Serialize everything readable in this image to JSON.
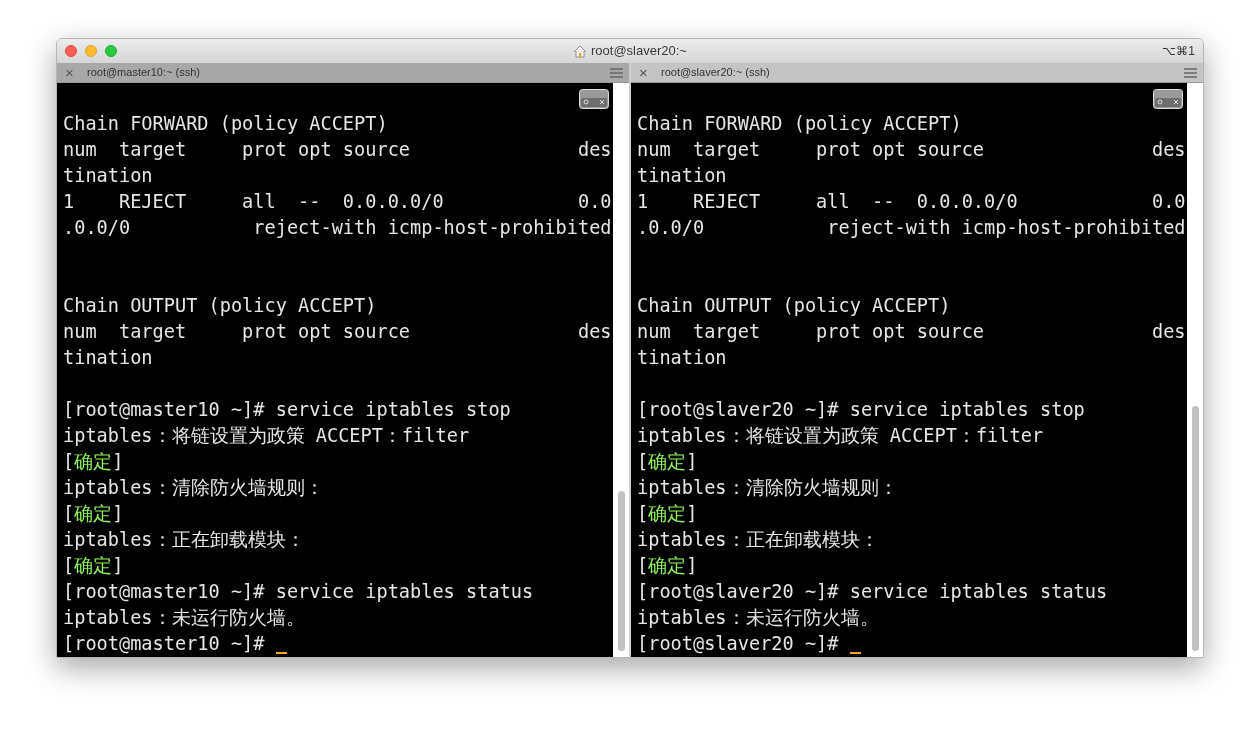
{
  "window": {
    "title": "root@slaver20:~",
    "shortcut": "⌥⌘1"
  },
  "panes": [
    {
      "tab": {
        "close": "×",
        "label": "root@master10:~ (ssh)"
      },
      "active": false,
      "lines": [
        {
          "kind": "blank"
        },
        {
          "kind": "text",
          "text": "Chain FORWARD (policy ACCEPT)"
        },
        {
          "kind": "text",
          "text": "num  target     prot opt source               des"
        },
        {
          "kind": "text",
          "text": "tination"
        },
        {
          "kind": "text",
          "text": "1    REJECT     all  --  0.0.0.0/0            0.0"
        },
        {
          "kind": "text",
          "text": ".0.0/0           reject-with icmp-host-prohibited"
        },
        {
          "kind": "blank"
        },
        {
          "kind": "blank"
        },
        {
          "kind": "text",
          "text": "Chain OUTPUT (policy ACCEPT)"
        },
        {
          "kind": "text",
          "text": "num  target     prot opt source               des"
        },
        {
          "kind": "text",
          "text": "tination"
        },
        {
          "kind": "blank"
        },
        {
          "kind": "text",
          "text": "[root@master10 ~]# service iptables stop"
        },
        {
          "kind": "text",
          "text": "iptables：将链设置为政策 ACCEPT：filter"
        },
        {
          "kind": "status",
          "open": "[",
          "status": "确定",
          "close": "]"
        },
        {
          "kind": "text",
          "text": "iptables：清除防火墙规则："
        },
        {
          "kind": "status",
          "open": "[",
          "status": "确定",
          "close": "]"
        },
        {
          "kind": "text",
          "text": "iptables：正在卸载模块："
        },
        {
          "kind": "status",
          "open": "[",
          "status": "确定",
          "close": "]"
        },
        {
          "kind": "text",
          "text": "[root@master10 ~]# service iptables status"
        },
        {
          "kind": "text",
          "text": "iptables：未运行防火墙。"
        },
        {
          "kind": "prompt",
          "text": "[root@master10 ~]#",
          "cursor": true
        }
      ]
    },
    {
      "tab": {
        "close": "×",
        "label": "root@slaver20:~ (ssh)"
      },
      "active": true,
      "lines": [
        {
          "kind": "blank"
        },
        {
          "kind": "text",
          "text": "Chain FORWARD (policy ACCEPT)"
        },
        {
          "kind": "text",
          "text": "num  target     prot opt source               des"
        },
        {
          "kind": "text",
          "text": "tination"
        },
        {
          "kind": "text",
          "text": "1    REJECT     all  --  0.0.0.0/0            0.0"
        },
        {
          "kind": "text",
          "text": ".0.0/0           reject-with icmp-host-prohibited"
        },
        {
          "kind": "blank"
        },
        {
          "kind": "blank"
        },
        {
          "kind": "text",
          "text": "Chain OUTPUT (policy ACCEPT)"
        },
        {
          "kind": "text",
          "text": "num  target     prot opt source               des"
        },
        {
          "kind": "text",
          "text": "tination"
        },
        {
          "kind": "blank"
        },
        {
          "kind": "text",
          "text": "[root@slaver20 ~]# service iptables stop"
        },
        {
          "kind": "text",
          "text": "iptables：将链设置为政策 ACCEPT：filter"
        },
        {
          "kind": "status",
          "open": "[",
          "status": "确定",
          "close": "]"
        },
        {
          "kind": "text",
          "text": "iptables：清除防火墙规则："
        },
        {
          "kind": "status",
          "open": "[",
          "status": "确定",
          "close": "]"
        },
        {
          "kind": "text",
          "text": "iptables：正在卸载模块："
        },
        {
          "kind": "status",
          "open": "[",
          "status": "确定",
          "close": "]"
        },
        {
          "kind": "text",
          "text": "[root@slaver20 ~]# service iptables status"
        },
        {
          "kind": "text",
          "text": "iptables：未运行防火墙。"
        },
        {
          "kind": "prompt",
          "text": "[root@slaver20 ~]#",
          "cursor": true
        }
      ]
    }
  ]
}
